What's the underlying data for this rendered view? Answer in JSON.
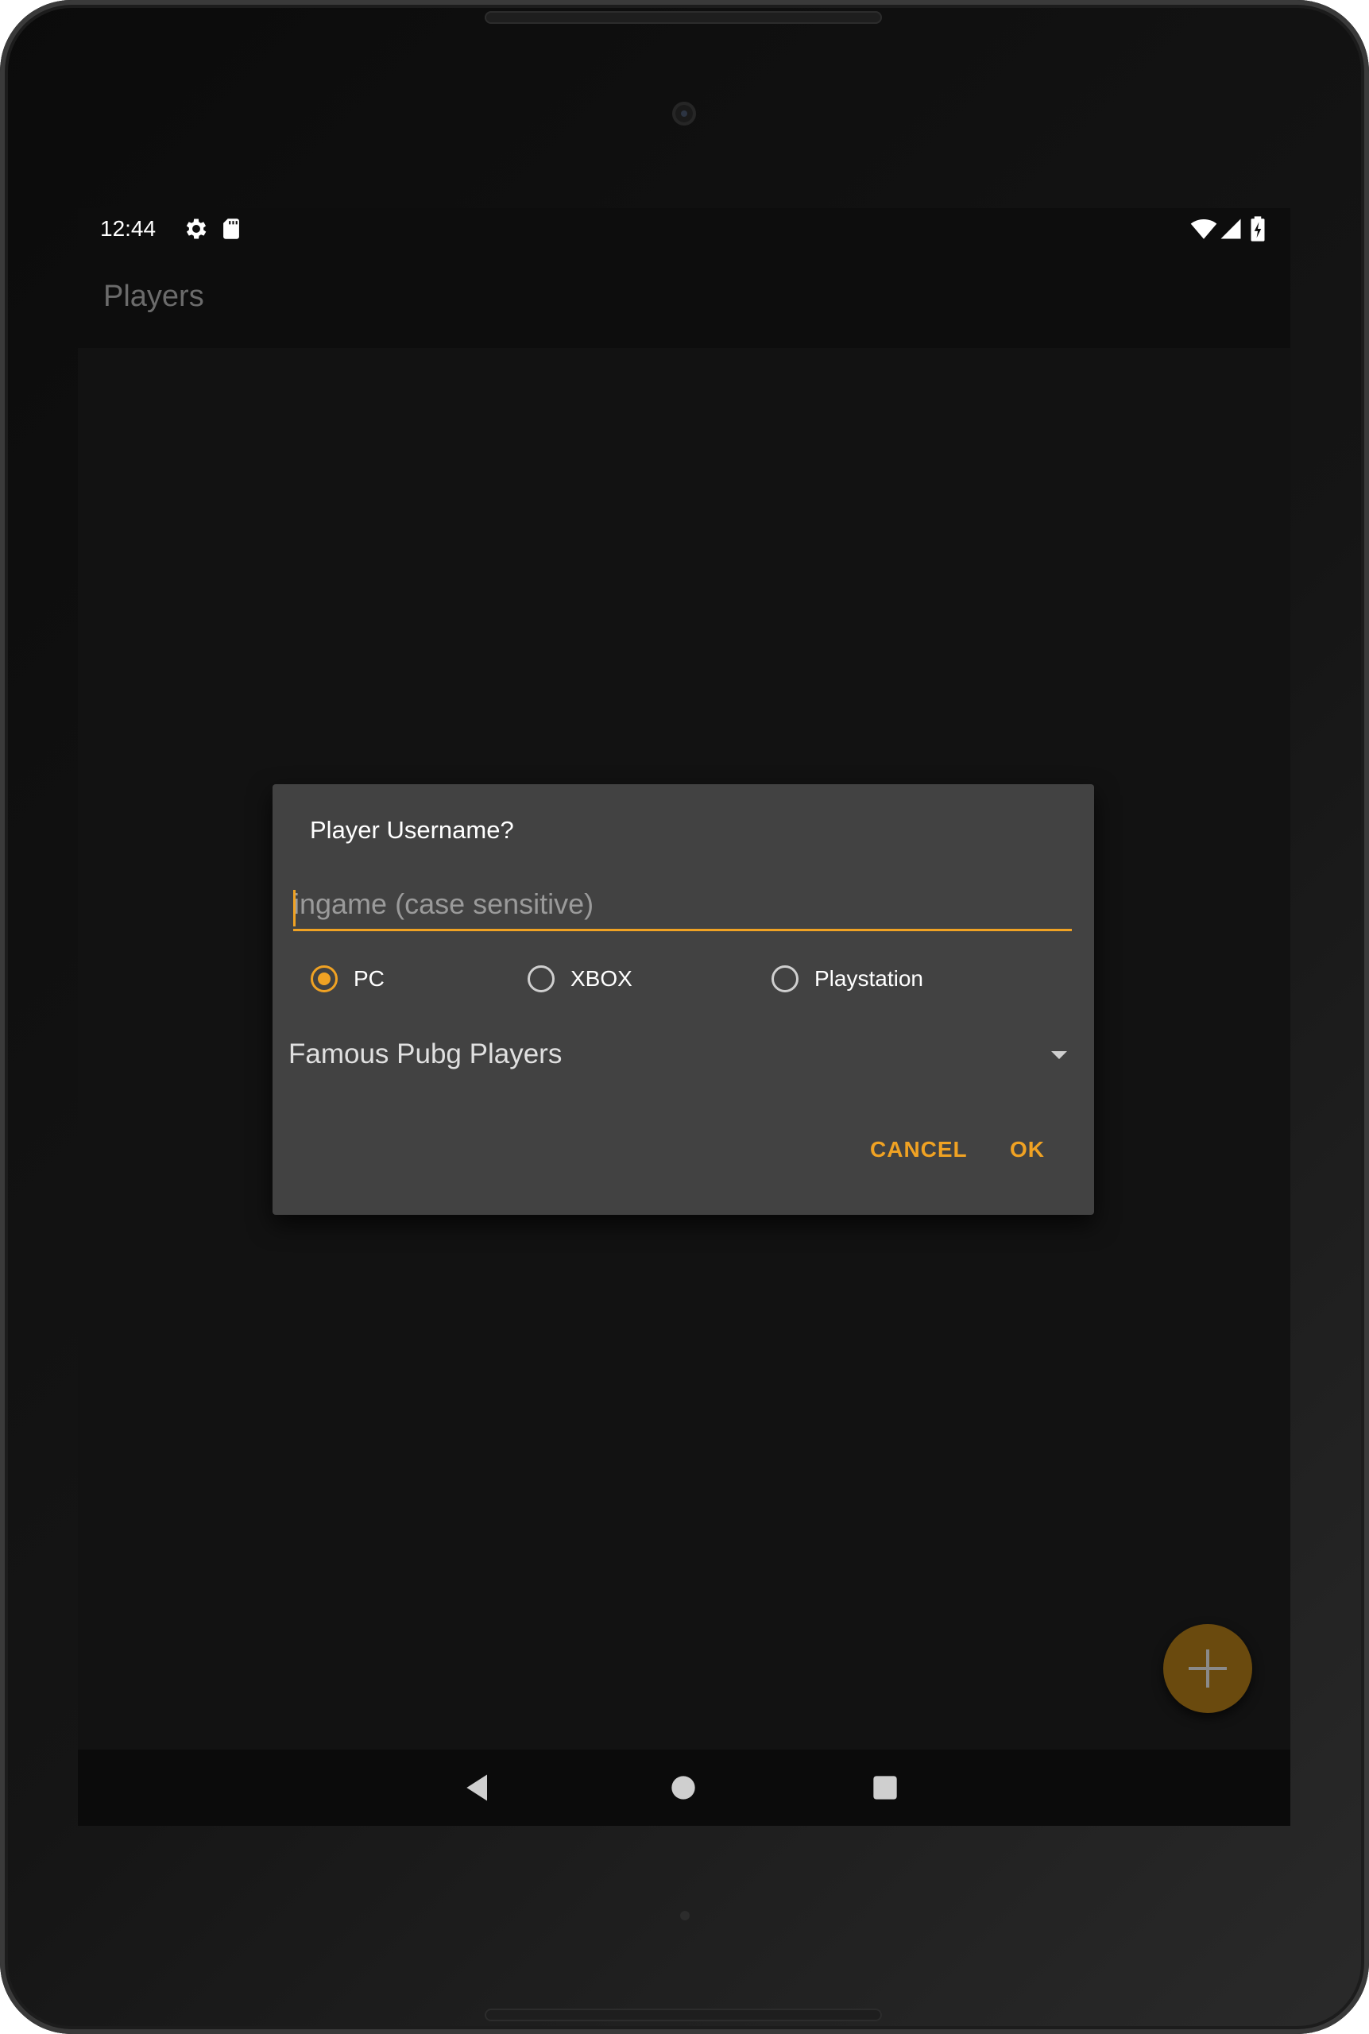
{
  "status_bar": {
    "time": "12:44",
    "icons": [
      "gear-icon",
      "sd-card-icon",
      "wifi-icon",
      "cell-signal-icon",
      "battery-charging-icon"
    ]
  },
  "app_bar": {
    "title": "Players"
  },
  "dialog": {
    "title": "Player Username?",
    "input": {
      "value": "",
      "placeholder": "ingame (case sensitive)"
    },
    "platform_options": [
      {
        "label": "PC",
        "checked": true
      },
      {
        "label": "XBOX",
        "checked": false
      },
      {
        "label": "Playstation",
        "checked": false
      }
    ],
    "spinner": {
      "selected": "Famous Pubg Players"
    },
    "buttons": {
      "cancel": "CANCEL",
      "ok": "OK"
    }
  },
  "fab": {
    "icon": "plus-icon"
  },
  "nav_bar": {
    "buttons": [
      "back-icon",
      "home-icon",
      "recents-icon"
    ]
  },
  "colors": {
    "accent": "#f0a223",
    "dialog_background": "#424242",
    "screen_background": "#121212",
    "fab_dimmed": "#6a4a0e"
  }
}
